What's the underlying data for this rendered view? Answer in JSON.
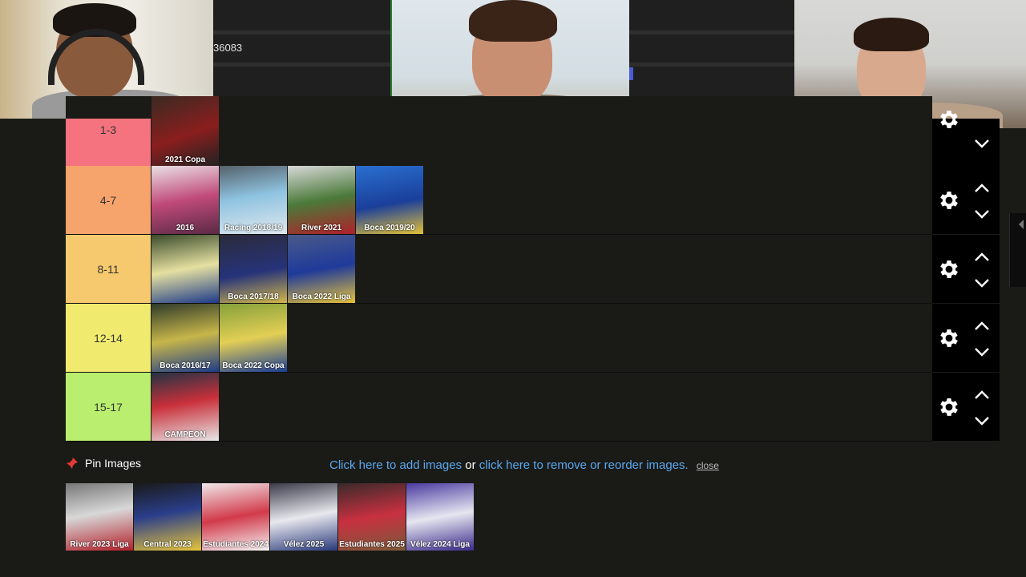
{
  "overlay": {
    "partial_id_text": "36083"
  },
  "tiers": [
    {
      "label": "1-3",
      "color": "#f4737e",
      "items": [
        {
          "caption": "2021 Copa",
          "bg": "linear-gradient(160deg,#3a2a22,#8a1e1e 55%,#222 100%)"
        }
      ]
    },
    {
      "label": "4-7",
      "color": "#f6a36c",
      "items": [
        {
          "caption": "2016",
          "bg": "linear-gradient(170deg,#eae0e4,#c04a7a 50%,#5a2a44 100%)"
        },
        {
          "caption": "Racing 2018/19",
          "bg": "linear-gradient(170deg,#55616a,#8ec3e0 45%,#e0e8ee 100%)"
        },
        {
          "caption": "River 2021",
          "bg": "linear-gradient(170deg,#d8d8d8,#4b7a3a 50%,#b0202a 100%)"
        },
        {
          "caption": "Boca 2019/20",
          "bg": "linear-gradient(170deg,#2a6fd0,#1a3f9a 55%,#e2c038 100%)"
        }
      ]
    },
    {
      "label": "8-11",
      "color": "#f6c96e",
      "items": [
        {
          "caption": "",
          "bg": "linear-gradient(170deg,#3a4b2c,#e5e0a0 50%,#1d3a8a 100%)"
        },
        {
          "caption": "Boca 2017/18",
          "bg": "linear-gradient(170deg,#2b2b3a,#26337a 55%,#d4b84a 100%)"
        },
        {
          "caption": "Boca 2022 Liga",
          "bg": "linear-gradient(170deg,#4a5a8a,#1f3a9a 50%,#e6c23a 100%)"
        }
      ]
    },
    {
      "label": "12-14",
      "color": "#f0ea6e",
      "items": [
        {
          "caption": "Boca 2016/17",
          "bg": "linear-gradient(170deg,#2f3a2a,#c7b64a 50%,#1e3c8a 100%)"
        },
        {
          "caption": "Boca 2022 Copa",
          "bg": "linear-gradient(170deg,#86a03a,#e3cf55 50%,#1c3e96 100%)"
        }
      ]
    },
    {
      "label": "15-17",
      "color": "#b9ee6e",
      "items": [
        {
          "caption": "CAMPEÓN",
          "bg": "linear-gradient(170deg,#223344,#c9303a 45%,#e6e6e6 100%)"
        }
      ]
    }
  ],
  "pin_label": "Pin Images",
  "links": {
    "add": "Click here to add images",
    "or": "or",
    "remove": "click here to remove or reorder images.",
    "close": "close"
  },
  "image_bank": [
    {
      "caption": "River 2023 Liga",
      "bg": "linear-gradient(170deg,#777,#d8d8d8 45%,#b3202a 100%)"
    },
    {
      "caption": "Central 2023",
      "bg": "linear-gradient(170deg,#1a1a1a,#2a3e8a 45%,#e6c43a 100%)"
    },
    {
      "caption": "Estudiantes 2024",
      "bg": "linear-gradient(170deg,#f0e8ea,#d23a4a 50%,#f3f3f3 100%)"
    },
    {
      "caption": "Vélez 2025",
      "bg": "linear-gradient(170deg,#3a3a4a,#e8e8ee 50%,#2a3a7a 100%)"
    },
    {
      "caption": "Estudiantes 2025",
      "bg": "linear-gradient(170deg,#3a2a2a,#c83040 50%,#7a5a3a 100%)"
    },
    {
      "caption": "Vélez 2024 Liga",
      "bg": "linear-gradient(170deg,#4a3aa0,#e6e6f0 50%,#3a2a8a 100%)"
    }
  ]
}
